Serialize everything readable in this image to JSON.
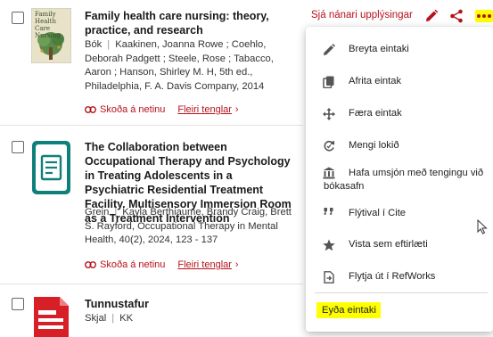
{
  "records": [
    {
      "title": "Family health care nursing: theory, practice, and research",
      "type": "Bók",
      "authors": "Kaakinen, Joanna Rowe ; Coehlo, Deborah Padgett ; Steele, Rose ; Tabacco, Aaron ; Hanson, Shirley M. H, 5th ed., Philadelphia, F. A. Davis Company, 2014",
      "cover_text": "Family Health Care Nursing",
      "link_online": "Skoða á netinu",
      "link_more": "Fleiri tenglar"
    },
    {
      "title": "The Collaboration between Occupational Therapy and Psychology in Treating Adolescents in a Psychiatric Residential Treatment Facility. Multisensory Immersion Room as a Treatment Intervention",
      "type": "Grein",
      "authors": "Kayla Berthiaume, Brandy Craig, Brett S. Rayford, Occupational Therapy in Mental Health, 40(2), 2024, 123 - 137",
      "link_online": "Skoða á netinu",
      "link_more": "Fleiri tenglar"
    },
    {
      "title": "Tunnustafur",
      "type": "Skjal",
      "authors": "KK"
    }
  ],
  "toolbar": {
    "details_link": "Sjá nánari upplýsingar"
  },
  "menu": {
    "items": [
      {
        "label": "Breyta eintaki",
        "icon": "pencil-icon"
      },
      {
        "label": "Afrita eintak",
        "icon": "copy-icon"
      },
      {
        "label": "Færa eintak",
        "icon": "move-icon"
      },
      {
        "label": "Mengi lokið",
        "icon": "refresh-icon"
      },
      {
        "label": "Hafa umsjón með tengingu við bókasafn",
        "icon": "library-icon"
      },
      {
        "label": "Flýtival í Cite",
        "icon": "quote-icon"
      },
      {
        "label": "Vista sem eftirlæti",
        "icon": "star-icon"
      },
      {
        "label": "Flytja út í RefWorks",
        "icon": "export-icon"
      }
    ],
    "delete_label": "Eyða eintaki"
  },
  "colors": {
    "accent": "#b5121b",
    "highlight": "#ffff00",
    "article_icon": "#0f7f7a",
    "document_icon": "#d61f26",
    "cover_green": "#5a8a4a"
  }
}
